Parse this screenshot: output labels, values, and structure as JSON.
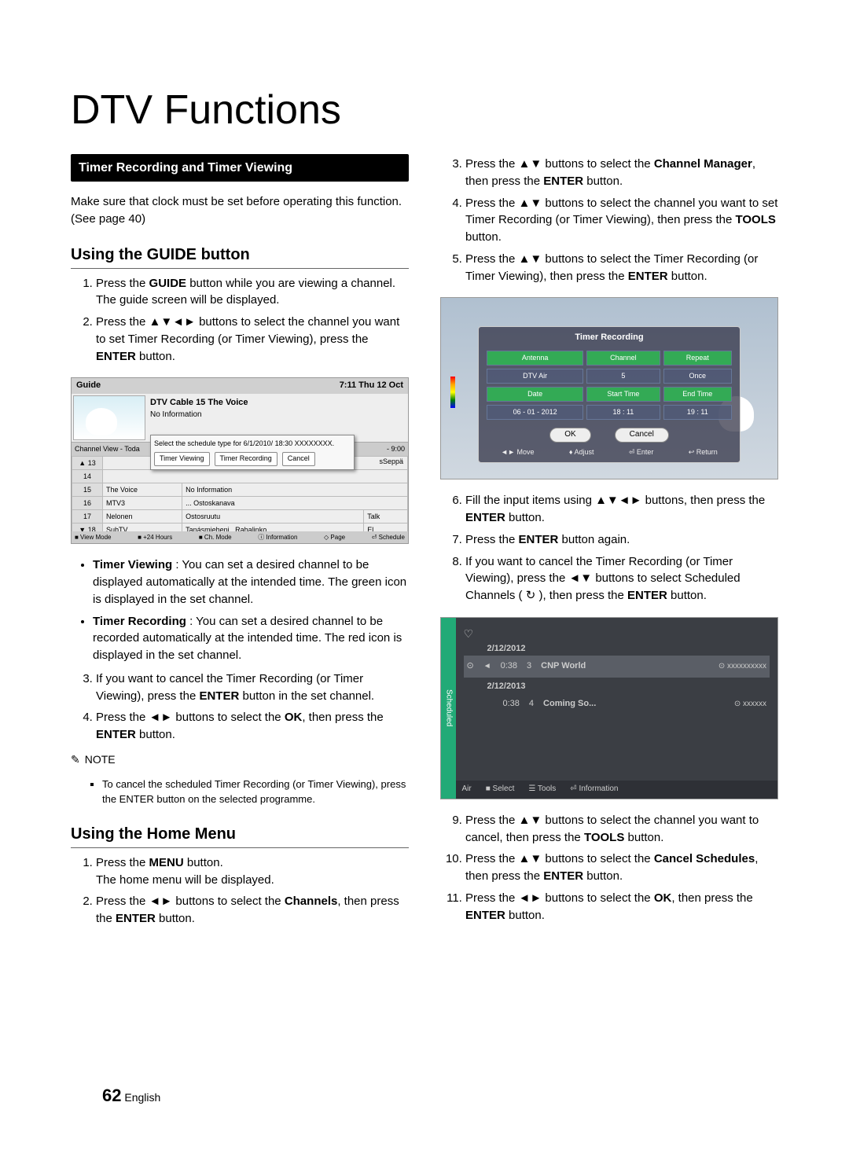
{
  "page": {
    "title": "DTV Functions",
    "section_bar": "Timer Recording and Timer Viewing",
    "intro": "Make sure that clock must be set before operating this function. (See page 40)",
    "sub1": "Using the GUIDE button",
    "ol1": {
      "i1a": "Press the ",
      "i1b": "GUIDE",
      "i1c": " button while you are viewing a channel.",
      "i1d": "The guide screen will be displayed.",
      "i2a": "Press the ▲▼◄► buttons to select the channel you want to set Timer Recording (or Timer Viewing), press the ",
      "i2b": "ENTER",
      "i2c": " button."
    },
    "bul1": {
      "b1a": "Timer Viewing",
      "b1b": " : You can set a desired channel to be displayed automatically at the intended time. The green icon is displayed in the set channel.",
      "b2a": "Timer Recording",
      "b2b": " : You can set a desired channel to be recorded automatically at the intended time. The red icon is displayed in the set channel."
    },
    "ol2": {
      "i3a": "If you want to cancel the Timer Recording (or Timer Viewing), press the ",
      "i3b": "ENTER",
      "i3c": " button in the set channel.",
      "i4a": "Press the ◄► buttons to select the ",
      "i4b": "OK",
      "i4c": ", then press the ",
      "i4d": "ENTER",
      "i4e": " button."
    },
    "note_label": "NOTE",
    "note1": "To cancel the scheduled Timer Recording (or Timer Viewing), press the ENTER button on the selected programme.",
    "sub2": "Using the Home Menu",
    "ol3": {
      "i1a": "Press the ",
      "i1b": "MENU",
      "i1c": " button.",
      "i1d": "The home menu will be displayed.",
      "i2a": "Press the ◄► buttons to select the ",
      "i2b": "Channels",
      "i2c": ", then press the ",
      "i2d": "ENTER",
      "i2e": " button."
    },
    "r_ol1": {
      "i3a": "Press the ▲▼ buttons to select the ",
      "i3b": "Channel Manager",
      "i3c": ", then press the ",
      "i3d": "ENTER",
      "i3e": " button.",
      "i4a": "Press the ▲▼ buttons to select the channel you want to set Timer Recording (or Timer Viewing), then press the ",
      "i4b": "TOOLS",
      "i4c": " button.",
      "i5a": "Press the ▲▼ buttons to select the Timer Recording (or Timer Viewing), then press the ",
      "i5b": "ENTER",
      "i5c": " button."
    },
    "r_ol2": {
      "i6a": "Fill the input items using ▲▼◄► buttons, then press the ",
      "i6b": "ENTER",
      "i6c": " button.",
      "i7a": "Press the ",
      "i7b": "ENTER",
      "i7c": " button again.",
      "i8a": "If you want to cancel the Timer Recording (or Timer Viewing), press the ◄▼ buttons to select Scheduled Channels ( ",
      "i8clock": "↻",
      "i8b": " ), then press the ",
      "i8c": "ENTER",
      "i8d": " button."
    },
    "r_ol3": {
      "i9a": "Press the ▲▼ buttons to select the channel you want to cancel, then press the ",
      "i9b": "TOOLS",
      "i9c": " button.",
      "i10a": "Press the ▲▼ buttons to select the ",
      "i10b": "Cancel Schedules",
      "i10c": ", then press the ",
      "i10d": "ENTER",
      "i10e": " button.",
      "i11a": "Press the ◄► buttons to select the ",
      "i11b": "OK",
      "i11c": ", then press the ",
      "i11d": "ENTER",
      "i11e": " button."
    },
    "page_num": "62",
    "page_lang": "English"
  },
  "fig1": {
    "title": "Guide",
    "clock": "7:11 Thu 12 Oct",
    "ch_title": "DTV Cable 15 The Voice",
    "no_info": "No Information",
    "sched_label": "Channel View - Toda",
    "popup_title": "Select the schedule type for 6/1/2010/ 18:30 XXXXXXXX.",
    "btn1": "Timer Viewing",
    "btn2": "Timer Recording",
    "btn3": "Cancel",
    "time_col": "- 9:00",
    "rows": {
      "r13": "13",
      "r14": "14",
      "r15_ch": "15",
      "r15_a": "The Voice",
      "r15_b": "No Information",
      "r16_ch": "16",
      "r16_a": "MTV3",
      "r16_b": "Ostoskanava",
      "r17_ch": "17",
      "r17_a": "Nelonen",
      "r17_b": "Ostosruutu",
      "r17_c": "Talk",
      "r18_ch": "18",
      "r18_a": "SubTV",
      "r18_b": "Tanásmieheni",
      "r18_c": "Rahalinko",
      "r18_d": "El ..."
    },
    "seppa": "sSeppä",
    "footer": {
      "a": "■ View Mode",
      "b": "■ +24 Hours",
      "c": "■ Ch. Mode",
      "d": "ⓘ Information",
      "e": "◇ Page",
      "f": "⏎ Schedule"
    }
  },
  "fig2": {
    "title": "Timer Recording",
    "h1": "Antenna",
    "h2": "Channel",
    "h3": "Repeat",
    "v1": "DTV Air",
    "v2": "5",
    "v3": "Once",
    "h4": "Date",
    "h5": "Start Time",
    "h6": "End Time",
    "v4": "06 - 01 - 2012",
    "v5": "18 : 11",
    "v6": "19 : 11",
    "ok": "OK",
    "cancel": "Cancel",
    "f1": "◄► Move",
    "f2": "♦ Adjust",
    "f3": "⏎ Enter",
    "f4": "↩ Return"
  },
  "fig3": {
    "tab": "Scheduled",
    "date1": "2/12/2012",
    "t1": "0:38",
    "ch1": "3",
    "name1": "CNP World",
    "tag1": "⊙ xxxxxxxxxx",
    "date2": "2/12/2013",
    "t2": "0:38",
    "ch2": "4",
    "name2": "Coming So...",
    "tag2": "⊙ xxxxxx",
    "footer": {
      "air": "Air",
      "a": "■ Select",
      "b": "☰ Tools",
      "c": "⏎ Information"
    }
  }
}
